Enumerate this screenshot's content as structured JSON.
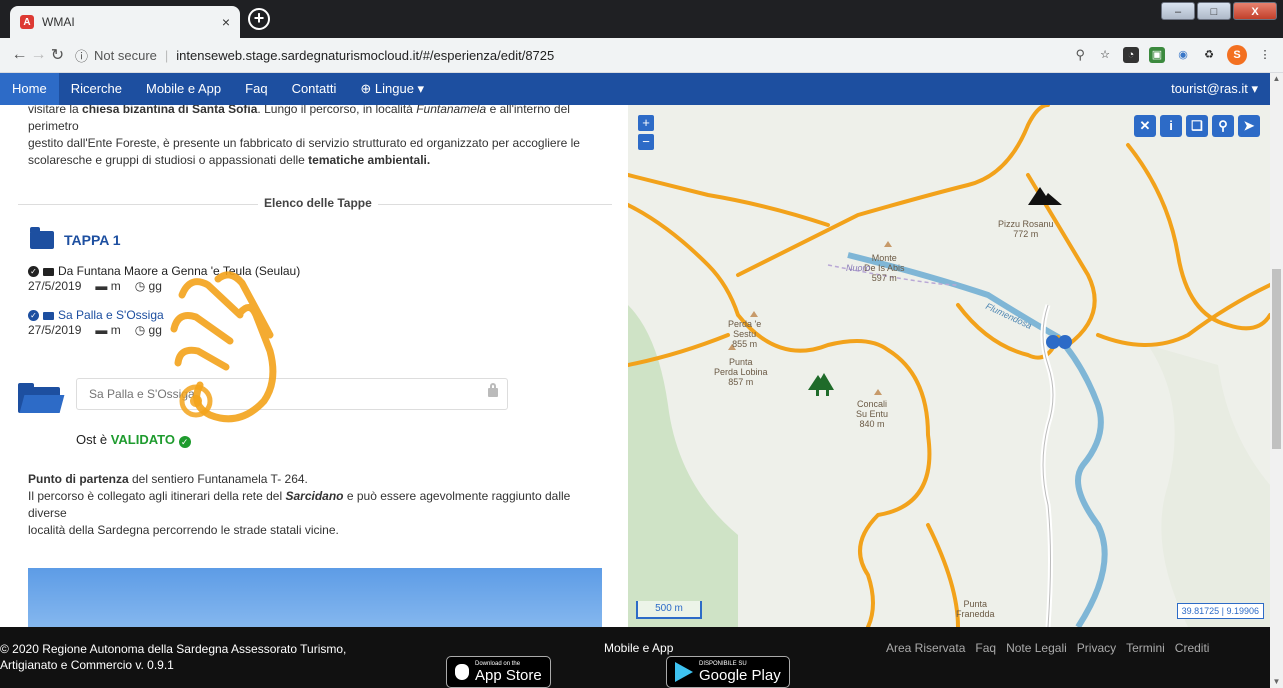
{
  "browser": {
    "tab_title": "WMAI",
    "tab_close": "×",
    "new_tab": "+",
    "security_label": "Not secure",
    "url": "intenseweb.stage.sardegnaturismocloud.it/#/esperienza/edit/8725",
    "profile_initial": "S",
    "window_controls": [
      "–",
      "□",
      "X"
    ]
  },
  "navbar": {
    "items": [
      "Home",
      "Ricerche",
      "Mobile e App",
      "Faq",
      "Contatti",
      "⊕ Lingue ▾"
    ],
    "active": "Home",
    "user": "tourist@ras.it ▾"
  },
  "intro": {
    "line1_pre": "visitare la ",
    "line1_bold": "chiesa bizantina di Santa Sofia",
    "line1_post": ". Lungo il percorso, in località ",
    "line1_italic": "Funtanamela",
    "line1_end": " e all'interno del perimetro",
    "line2": "gestito dall'Ente Foreste, è presente un fabbricato di servizio strutturato ed organizzato per accogliere le",
    "line3_pre": "scolaresche e gruppi di studiosi o appassionati delle ",
    "line3_bold": "tematiche ambientali."
  },
  "section": {
    "title": "Elenco delle Tappe"
  },
  "tappa": {
    "label": "TAPPA 1",
    "stages": [
      {
        "name": "Da Funtana Maore a Genna 'e Teula (Seulau)",
        "date": "27/5/2019",
        "dist": "m",
        "time": "gg"
      },
      {
        "name": "Sa Palla e S'Ossiga",
        "date": "27/5/2019",
        "dist": "m",
        "time": "gg"
      }
    ]
  },
  "ost": {
    "placeholder": "Sa Palla e S'Ossiga",
    "status_prefix": "Ost è ",
    "status_value": "VALIDATO"
  },
  "partenza": {
    "line1_bold": "Punto di partenza",
    "line1_rest": " del sentiero Funtanamela T- 264.",
    "line2_pre": "Il percorso è collegato agli itinerari della rete del ",
    "line2_italic": "Sarcidano",
    "line2_post": " e può essere agevolmente raggiunto dalle diverse",
    "line3": "località della Sardegna percorrendo le strade statali vicine."
  },
  "map": {
    "zoom_in": "+",
    "zoom_out": "−",
    "tools": [
      "✕",
      "i",
      "❑",
      "⚲",
      "➤"
    ],
    "labels": {
      "pizzu": "Pizzu Rosanu\n772 m",
      "monte": "Monte\nDe Is Abis\n597 m",
      "perda_sestu": "Perda 'e\nSestu\n855 m",
      "punta_perda": "Punta\nPerda Lobina\n857 m",
      "concali": "Concali\nSu Entu\n840 m",
      "nuoro": "Nuoro",
      "flumendosa": "Flumendosa",
      "punta_bottom": "Punta\nFranedda"
    },
    "scale": "500 m",
    "coords": "39.81725 | 9.19906",
    "colors": {
      "road": "#f2a21b",
      "water": "#7fb6d6",
      "forest": "#cfe3c6"
    }
  },
  "footer": {
    "copyright_line1": "© 2020 Regione Autonoma della Sardegna Assessorato Turismo,",
    "copyright_line2": "Artigianato e Commercio v. 0.9.1",
    "mobile_label": "Mobile e App",
    "appstore_small": "Download on the",
    "appstore_big": "App Store",
    "googleplay_small": "DISPONIBILE SU",
    "googleplay_big": "Google Play",
    "links": [
      "Area Riservata",
      "Faq",
      "Note Legali",
      "Privacy",
      "Termini",
      "Crediti"
    ]
  }
}
